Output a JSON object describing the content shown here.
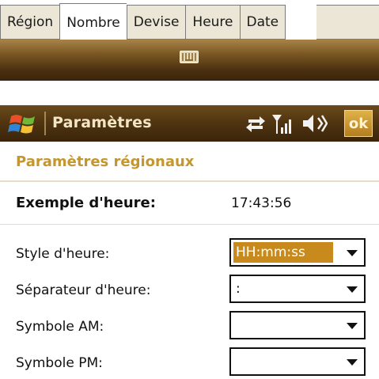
{
  "tabs": [
    {
      "label": "Région",
      "active": false
    },
    {
      "label": "Nombre",
      "active": true
    },
    {
      "label": "Devise",
      "active": false
    },
    {
      "label": "Heure",
      "active": false
    },
    {
      "label": "Date",
      "active": false
    }
  ],
  "titlebar": {
    "title": "Paramètres",
    "ok_label": "ok"
  },
  "section": {
    "title": "Paramètres régionaux"
  },
  "example": {
    "label": "Exemple d'heure:",
    "value": "17:43:56"
  },
  "fields": {
    "time_style": {
      "label": "Style d'heure:",
      "value": "HH:mm:ss"
    },
    "time_separator": {
      "label": "Séparateur d'heure:",
      "value": ":"
    },
    "am_symbol": {
      "label": "Symbole AM:",
      "value": ""
    },
    "pm_symbol": {
      "label": "Symbole PM:",
      "value": ""
    }
  },
  "icons": {
    "start": "windows-flag-icon",
    "sip": "keyboard-icon",
    "connectivity": "connectivity-arrows-icon",
    "signal": "signal-strength-icon",
    "volume": "volume-icon"
  },
  "colors": {
    "accent": "#c4962e",
    "selection": "#c88a1c",
    "titlebar": "#4f3410"
  }
}
